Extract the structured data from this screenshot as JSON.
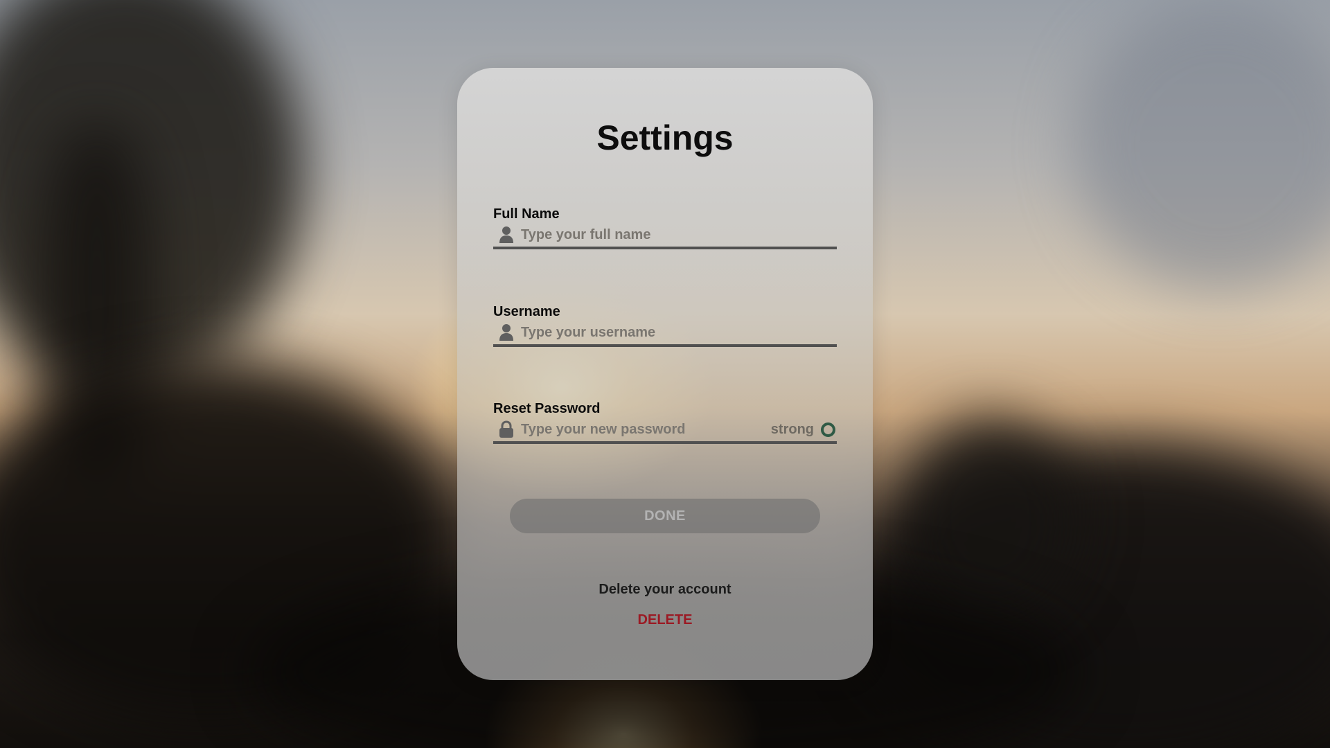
{
  "page": {
    "title": "Settings"
  },
  "fields": {
    "full_name": {
      "label": "Full Name",
      "placeholder": "Type your full name",
      "value": "",
      "icon": "user-icon"
    },
    "username": {
      "label": "Username",
      "placeholder": "Type your username",
      "value": "",
      "icon": "user-icon"
    },
    "password": {
      "label": "Reset Password",
      "placeholder": "Type your new password",
      "value": "",
      "icon": "lock-icon",
      "strength_label": "strong",
      "strength_color": "#2f5a45"
    }
  },
  "actions": {
    "done_label": "DONE",
    "delete_caption": "Delete your account",
    "delete_label": "DELETE",
    "delete_color": "#9b1a24"
  }
}
